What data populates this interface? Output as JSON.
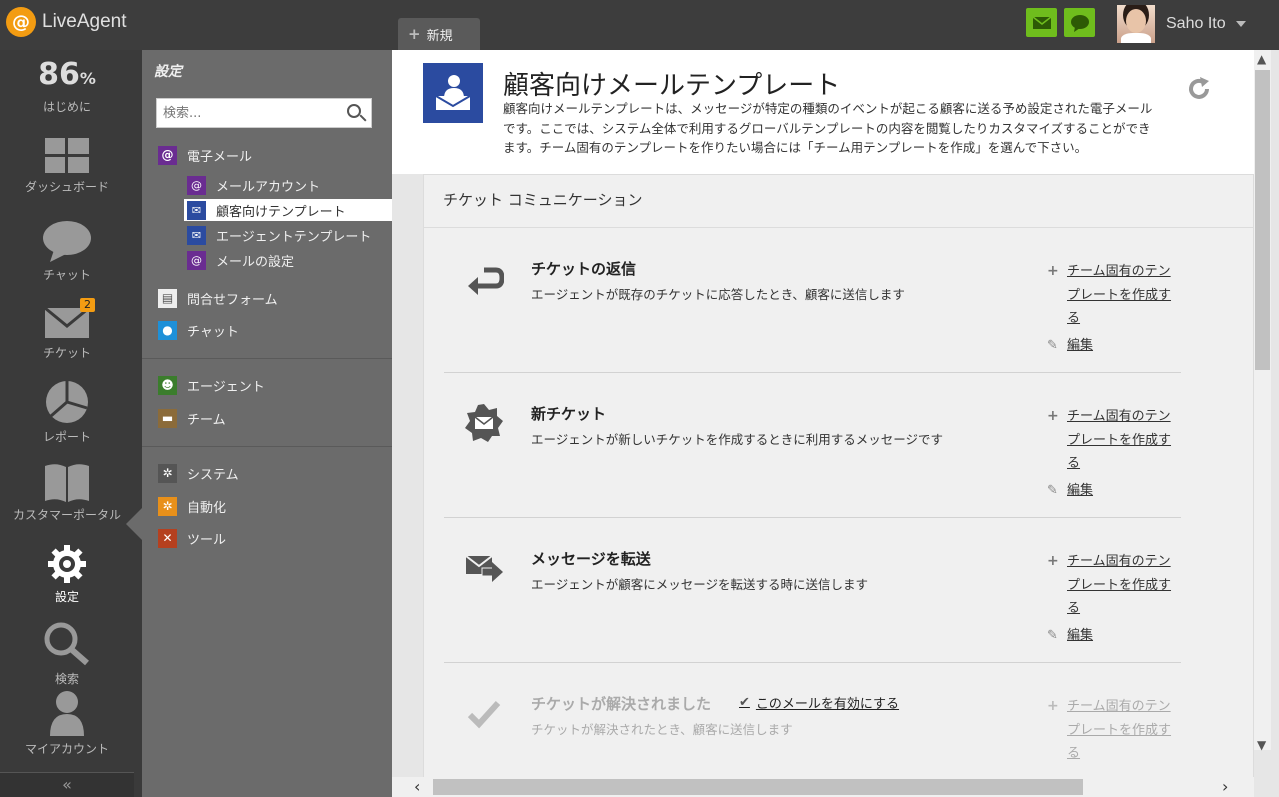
{
  "app": {
    "logo_text": "LiveAgent",
    "logo_mark": "@"
  },
  "tabs": [
    {
      "label": "新規"
    }
  ],
  "user": {
    "name": "Saho Ito"
  },
  "leftnav": {
    "progress_value": "86",
    "progress_unit": "%",
    "items": [
      {
        "label": "はじめに"
      },
      {
        "label": "ダッシュボード"
      },
      {
        "label": "チャット"
      },
      {
        "label": "チケット",
        "badge": "2"
      },
      {
        "label": "レポート"
      },
      {
        "label": "カスタマーポータル"
      },
      {
        "label": "設定"
      },
      {
        "label": "検索"
      },
      {
        "label": "マイアカウント"
      }
    ],
    "collapse": "«"
  },
  "settings": {
    "title": "設定",
    "search_placeholder": "検索...",
    "email_label": "電子メール",
    "email_sub": [
      {
        "label": "メールアカウント"
      },
      {
        "label": "顧客向けテンプレート"
      },
      {
        "label": "エージェントテンプレート"
      },
      {
        "label": "メールの設定"
      }
    ],
    "items": [
      {
        "label": "問合せフォーム"
      },
      {
        "label": "チャット"
      },
      {
        "label": "エージェント"
      },
      {
        "label": "チーム"
      },
      {
        "label": "システム"
      },
      {
        "label": "自動化"
      },
      {
        "label": "ツール"
      }
    ]
  },
  "main": {
    "title": "顧客向けメールテンプレート",
    "description": "顧客向けメールテンプレートは、メッセージが特定の種類のイベントが起こる顧客に送る予め設定された電子メールです。ここでは、システム全体で利用するグローバルテンプレートの内容を閲覧したりカスタマイズすることができます。チーム固有のテンプレートを作りたい場合には「チーム用テンプレートを作成」を選んで下さい。",
    "panel_title": "チケット コミュニケーション",
    "rows": [
      {
        "title": "チケットの返信",
        "desc": "エージェントが既存のチケットに応答したとき、顧客に送信します",
        "create": "チーム固有のテンプレートを作成する",
        "edit": "編集"
      },
      {
        "title": "新チケット",
        "desc": "エージェントが新しいチケットを作成するときに利用するメッセージです",
        "create": "チーム固有のテンプレートを作成する",
        "edit": "編集"
      },
      {
        "title": "メッセージを転送",
        "desc": "エージェントが顧客にメッセージを転送する時に送信します",
        "create": "チーム固有のテンプレートを作成する",
        "edit": "編集"
      },
      {
        "title": "チケットが解決されました",
        "desc": "チケットが解決されたとき、顧客に送信します",
        "create": "チーム固有のテンプレートを作成する",
        "enable": "このメールを有効にする"
      }
    ]
  },
  "colors": {
    "accent_green": "#6fbd1d",
    "purple": "#6a2c91",
    "navy": "#2b4ba0",
    "orange": "#f39c12"
  }
}
